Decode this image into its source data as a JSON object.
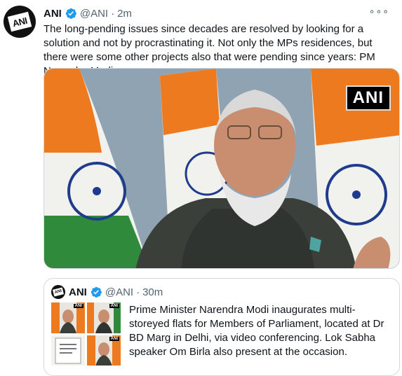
{
  "tweet": {
    "name": "ANI",
    "handle": "@ANI",
    "separator": "·",
    "time": "2m",
    "more": "∘∘∘",
    "text": "The long-pending issues since decades are resolved by looking for a solution and not by procrastinating it. Not only the MPs residences, but there were some other projects also that were pending since years: PM Narendra Modi",
    "avatar_logo": "ANI",
    "media_badge": "ANI"
  },
  "quote": {
    "name": "ANI",
    "handle": "@ANI",
    "separator": "·",
    "time": "30m",
    "text": "Prime Minister Narendra Modi inaugurates multi-storeyed flats for Members of Parliament, located at Dr BD Marg in Delhi, via video conferencing. Lok Sabha speaker Om Birla also present at the occasion.",
    "thumb_badge": "ANI"
  },
  "colors": {
    "verified": "#1d9bf0",
    "secondary_text": "#536471",
    "border": "#cfd9de",
    "saffron": "#ee7a1f",
    "green": "#2f8a3c",
    "chakra": "#1f3b8c"
  }
}
